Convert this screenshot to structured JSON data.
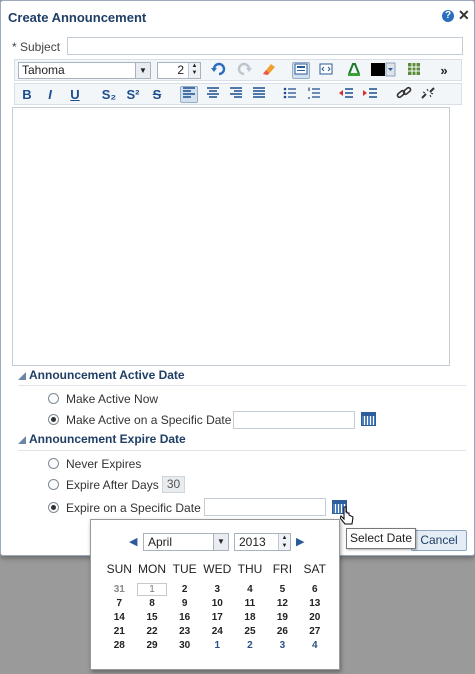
{
  "dialog": {
    "title": "Create Announcement",
    "help_icon_text": "?",
    "close_icon_text": "✕"
  },
  "subject": {
    "label": "* Subject",
    "value": ""
  },
  "toolbar": {
    "font": "Tahoma",
    "font_size": "2",
    "row2": {
      "bold": "B",
      "italic": "I",
      "underline": "U",
      "subscript": "S₂",
      "superscript": "S²",
      "strike": "S"
    }
  },
  "active_date": {
    "header": "Announcement Active Date",
    "make_active_now": "Make Active Now",
    "make_active_specific": "Make Active on a Specific Date"
  },
  "expire_date": {
    "header": "Announcement Expire Date",
    "never": "Never Expires",
    "after_days": "Expire After Days",
    "days_value": "30",
    "specific": "Expire on a Specific Date"
  },
  "buttons": {
    "cancel": "Cancel"
  },
  "tooltip": "Select Date",
  "calendar": {
    "month": "April",
    "year": "2013",
    "weekdays": [
      "SUN",
      "MON",
      "TUE",
      "WED",
      "THU",
      "FRI",
      "SAT"
    ],
    "weeks": [
      [
        "31",
        "1",
        "2",
        "3",
        "4",
        "5",
        "6"
      ],
      [
        "7",
        "8",
        "9",
        "10",
        "11",
        "12",
        "13"
      ],
      [
        "14",
        "15",
        "16",
        "17",
        "18",
        "19",
        "20"
      ],
      [
        "21",
        "22",
        "23",
        "24",
        "25",
        "26",
        "27"
      ],
      [
        "28",
        "29",
        "30",
        "1",
        "2",
        "3",
        "4"
      ]
    ]
  }
}
